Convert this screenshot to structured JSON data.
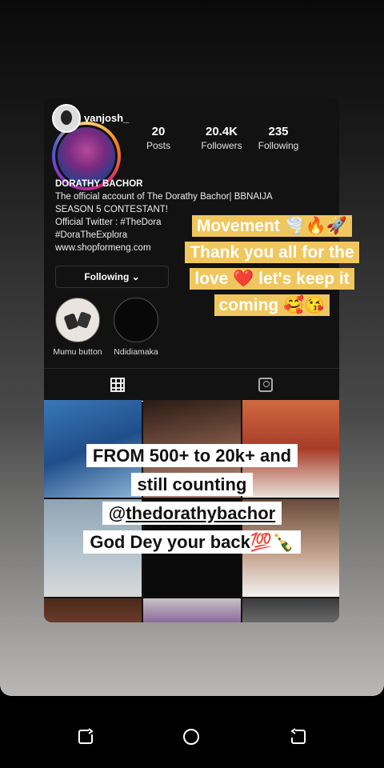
{
  "profile": {
    "tagged_user": "vanjosh_",
    "stats": [
      {
        "value": "20",
        "label": "Posts"
      },
      {
        "value": "20.4K",
        "label": "Followers"
      },
      {
        "value": "235",
        "label": "Following"
      }
    ],
    "name": "DORATHY BACHOR",
    "bio_lines": [
      "The official account of The Dorathy Bachor| BBNAIJA",
      "SEASON 5 CONTESTANT!",
      "Official Twitter : #TheDora",
      "#DoraTheExplora",
      "www.shopformeng.com"
    ],
    "follow_button": "Following ⌄",
    "highlights": [
      {
        "label": "Mumu button"
      },
      {
        "label": "Ndidiamaka"
      }
    ]
  },
  "tabs": [
    {
      "icon": "grid-icon",
      "active": true
    },
    {
      "icon": "tagged-icon",
      "active": false
    }
  ],
  "story_text_1": {
    "lines": [
      "Movement 🌪️🔥🚀",
      "Thank you all for the",
      "love ❤️ let's keep it",
      "coming 🥰😘"
    ],
    "bg_color": "#f0c75e"
  },
  "story_text_2": {
    "line1": "FROM 500+ to 20k+ and",
    "line2": "still counting",
    "line3_prefix": "@",
    "line3_handle": "thedorathybachor",
    "line4": "God Dey your back💯🍾"
  },
  "nav": {
    "recent": "recent-apps-icon",
    "home": "home-icon",
    "back": "back-icon"
  }
}
